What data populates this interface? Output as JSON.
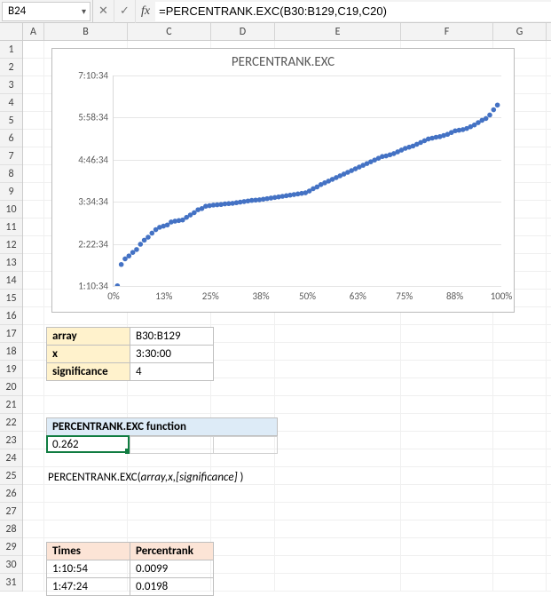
{
  "formula_bar": {
    "cell_ref": "B24",
    "cancel_glyph": "✕",
    "confirm_glyph": "✓",
    "fx_label": "fx",
    "formula": "=PERCENTRANK.EXC(B30:B129,C19,C20)"
  },
  "columns": [
    "A",
    "B",
    "C",
    "D",
    "E",
    "F",
    "G"
  ],
  "rows_start": 1,
  "rows_end": 31,
  "params": {
    "array": {
      "label": "array",
      "value": "B30:B129"
    },
    "x": {
      "label": "x",
      "value": "3:30:00"
    },
    "significance": {
      "label": "significance",
      "value": "4"
    }
  },
  "function": {
    "header": "PERCENTRANK.EXC function",
    "result": "0.262",
    "syntax_name": "PERCENTRANK.EXC(",
    "syntax_args": "array,x,[significance]",
    "syntax_close": " )"
  },
  "data_table": {
    "head_times": "Times",
    "head_rank": "Percentrank",
    "rows": [
      {
        "time": "1:10:54",
        "rank": "0.0099"
      },
      {
        "time": "1:47:24",
        "rank": "0.0198"
      }
    ]
  },
  "chart_data": {
    "type": "scatter",
    "title": "PERCENTRANK.EXC",
    "xlabel": "",
    "ylabel": "",
    "x_ticks_pct": [
      0,
      13,
      25,
      38,
      50,
      63,
      75,
      88,
      100
    ],
    "y_ticks": [
      "1:10:34",
      "2:22:34",
      "3:34:34",
      "4:46:34",
      "5:58:34",
      "7:10:34"
    ],
    "y_range_minutes": [
      70.57,
      430.57
    ],
    "series": [
      {
        "name": "values",
        "color": "#4472c4",
        "points": [
          [
            0.99,
            70.9
          ],
          [
            1.98,
            107.4
          ],
          [
            2.97,
            117.0
          ],
          [
            3.96,
            122.0
          ],
          [
            4.95,
            128.0
          ],
          [
            5.94,
            133.0
          ],
          [
            6.93,
            142.0
          ],
          [
            7.92,
            149.0
          ],
          [
            8.91,
            154.0
          ],
          [
            9.9,
            161.0
          ],
          [
            10.89,
            167.0
          ],
          [
            11.88,
            171.0
          ],
          [
            12.87,
            173.0
          ],
          [
            13.86,
            175.0
          ],
          [
            14.85,
            180.0
          ],
          [
            15.84,
            181.5
          ],
          [
            16.83,
            182.5
          ],
          [
            17.82,
            183.5
          ],
          [
            18.81,
            188.0
          ],
          [
            19.8,
            192.0
          ],
          [
            20.79,
            196.0
          ],
          [
            21.78,
            201.0
          ],
          [
            22.77,
            203.0
          ],
          [
            23.76,
            207.0
          ],
          [
            24.75,
            208.0
          ],
          [
            25.74,
            209.0
          ],
          [
            26.73,
            209.5
          ],
          [
            27.72,
            210.0
          ],
          [
            28.71,
            211.0
          ],
          [
            29.7,
            211.5
          ],
          [
            30.69,
            212.0
          ],
          [
            31.68,
            213.0
          ],
          [
            32.67,
            214.0
          ],
          [
            33.66,
            215.0
          ],
          [
            34.65,
            216.0
          ],
          [
            35.64,
            217.0
          ],
          [
            36.63,
            217.5
          ],
          [
            37.62,
            218.0
          ],
          [
            38.61,
            219.0
          ],
          [
            39.6,
            220.0
          ],
          [
            40.59,
            221.0
          ],
          [
            41.58,
            222.0
          ],
          [
            42.57,
            223.0
          ],
          [
            43.56,
            224.0
          ],
          [
            44.55,
            225.0
          ],
          [
            45.54,
            226.0
          ],
          [
            46.53,
            227.0
          ],
          [
            47.52,
            228.0
          ],
          [
            48.51,
            229.0
          ],
          [
            49.5,
            230.0
          ],
          [
            50.49,
            233.0
          ],
          [
            51.48,
            237.0
          ],
          [
            52.47,
            240.0
          ],
          [
            53.46,
            244.0
          ],
          [
            54.45,
            247.0
          ],
          [
            55.44,
            250.0
          ],
          [
            56.43,
            253.0
          ],
          [
            57.42,
            256.0
          ],
          [
            58.41,
            259.0
          ],
          [
            59.4,
            262.0
          ],
          [
            60.39,
            265.0
          ],
          [
            61.38,
            268.0
          ],
          [
            62.37,
            271.0
          ],
          [
            63.36,
            274.0
          ],
          [
            64.35,
            277.0
          ],
          [
            65.34,
            280.0
          ],
          [
            66.33,
            283.0
          ],
          [
            67.32,
            286.0
          ],
          [
            68.31,
            289.0
          ],
          [
            69.3,
            292.0
          ],
          [
            70.29,
            293.0
          ],
          [
            71.28,
            295.0
          ],
          [
            72.27,
            297.0
          ],
          [
            73.26,
            300.0
          ],
          [
            74.25,
            303.0
          ],
          [
            75.24,
            306.0
          ],
          [
            76.23,
            308.0
          ],
          [
            77.22,
            310.0
          ],
          [
            78.21,
            313.0
          ],
          [
            79.2,
            316.0
          ],
          [
            80.19,
            319.0
          ],
          [
            81.18,
            322.0
          ],
          [
            82.17,
            323.5
          ],
          [
            83.16,
            325.0
          ],
          [
            84.15,
            326.0
          ],
          [
            85.14,
            328.0
          ],
          [
            86.13,
            330.0
          ],
          [
            87.12,
            333.0
          ],
          [
            88.11,
            336.0
          ],
          [
            89.1,
            337.0
          ],
          [
            90.09,
            338.0
          ],
          [
            91.08,
            340.0
          ],
          [
            92.07,
            343.0
          ],
          [
            93.06,
            346.0
          ],
          [
            94.05,
            350.0
          ],
          [
            95.04,
            354.0
          ],
          [
            96.03,
            357.0
          ],
          [
            97.02,
            363.0
          ],
          [
            98.01,
            372.0
          ],
          [
            99.0,
            380.0
          ]
        ]
      }
    ]
  }
}
